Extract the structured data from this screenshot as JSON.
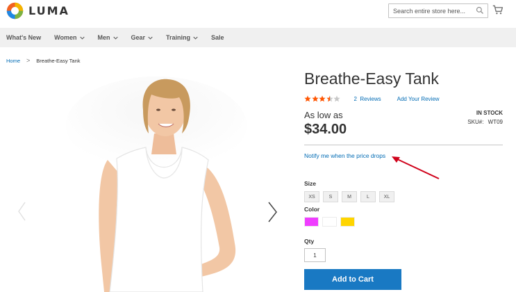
{
  "header": {
    "logo_text": "LUMA",
    "search_placeholder": "Search entire store here...",
    "icons": {
      "logo": "luma-logo",
      "search": "search-icon",
      "cart": "cart-icon"
    }
  },
  "nav": {
    "items": [
      {
        "label": "What's New",
        "has_dropdown": false
      },
      {
        "label": "Women",
        "has_dropdown": true
      },
      {
        "label": "Men",
        "has_dropdown": true
      },
      {
        "label": "Gear",
        "has_dropdown": true
      },
      {
        "label": "Training",
        "has_dropdown": true
      },
      {
        "label": "Sale",
        "has_dropdown": false
      }
    ]
  },
  "breadcrumb": {
    "home": "Home",
    "separator": ">",
    "current": "Breathe-Easy Tank"
  },
  "product": {
    "title": "Breathe-Easy Tank",
    "rating_stars": 3.5,
    "rating_max": 5,
    "reviews_link": "2  Reviews",
    "add_review_link": "Add Your Review",
    "as_low_as": "As low as",
    "price": "$34.00",
    "stock": "IN STOCK",
    "sku_label": "SKU#:",
    "sku_value": "WT09",
    "notify_link": "Notify me when the price drops",
    "size_label": "Size",
    "sizes": [
      "XS",
      "S",
      "M",
      "L",
      "XL"
    ],
    "color_label": "Color",
    "colors": [
      "#ef3dff",
      "#ffffff",
      "#ffd500"
    ],
    "qty_label": "Qty",
    "qty_value": "1",
    "add_to_cart": "Add to Cart"
  },
  "colors": {
    "link": "#006bb4",
    "primary_button": "#1979c3",
    "star": "#ff5501",
    "nav_bg": "#f0f0f0",
    "annotation_arrow": "#d0021b"
  }
}
